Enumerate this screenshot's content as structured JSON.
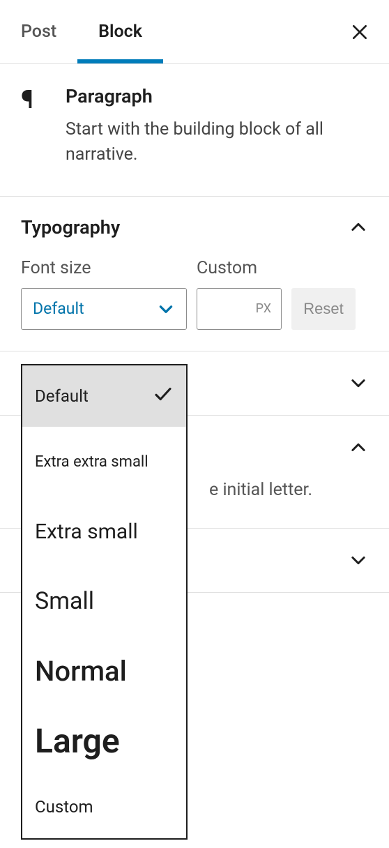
{
  "tabs": {
    "post": "Post",
    "block": "Block"
  },
  "block_card": {
    "title": "Paragraph",
    "description": "Start with the building block of all narrative.",
    "icon": "paragraph-icon"
  },
  "typography": {
    "panel_title": "Typography",
    "font_size_label": "Font size",
    "custom_label": "Custom",
    "selected": "Default",
    "px_unit": "PX",
    "reset_label": "Reset",
    "options": [
      {
        "label": "Default",
        "selected": true
      },
      {
        "label": "Extra extra small"
      },
      {
        "label": "Extra small"
      },
      {
        "label": "Small"
      },
      {
        "label": "Normal"
      },
      {
        "label": "Large"
      },
      {
        "label": "Custom"
      }
    ]
  },
  "bg_text": {
    "initial_letter_fragment": "e initial letter."
  },
  "icons": {
    "close": "close-icon",
    "chevron_up": "chevron-up-icon",
    "chevron_down": "chevron-down-icon",
    "check": "check-icon"
  }
}
